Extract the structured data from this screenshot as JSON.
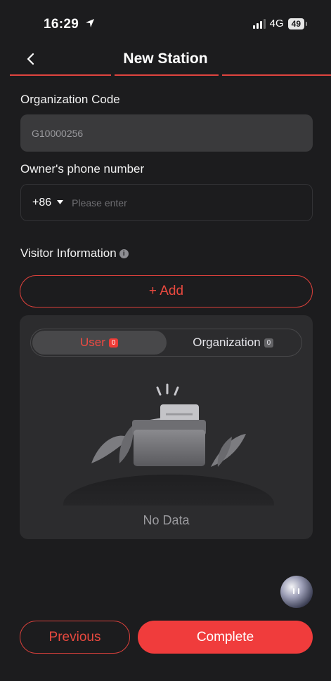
{
  "status_bar": {
    "time": "16:29",
    "network": "4G",
    "battery": "49"
  },
  "header": {
    "title": "New Station"
  },
  "form": {
    "org_code_label": "Organization Code",
    "org_code_value": "G10000256",
    "phone_label": "Owner's phone number",
    "country_code": "+86",
    "phone_placeholder": "Please enter"
  },
  "visitor": {
    "label": "Visitor Information",
    "add_label": "+ Add",
    "tabs": [
      {
        "label": "User",
        "count": "0"
      },
      {
        "label": "Organization",
        "count": "0"
      }
    ],
    "empty_text": "No Data"
  },
  "footer": {
    "previous_label": "Previous",
    "complete_label": "Complete"
  },
  "colors": {
    "accent": "#f03c3c",
    "background": "#1c1c1e",
    "panel": "#2c2c2e"
  }
}
